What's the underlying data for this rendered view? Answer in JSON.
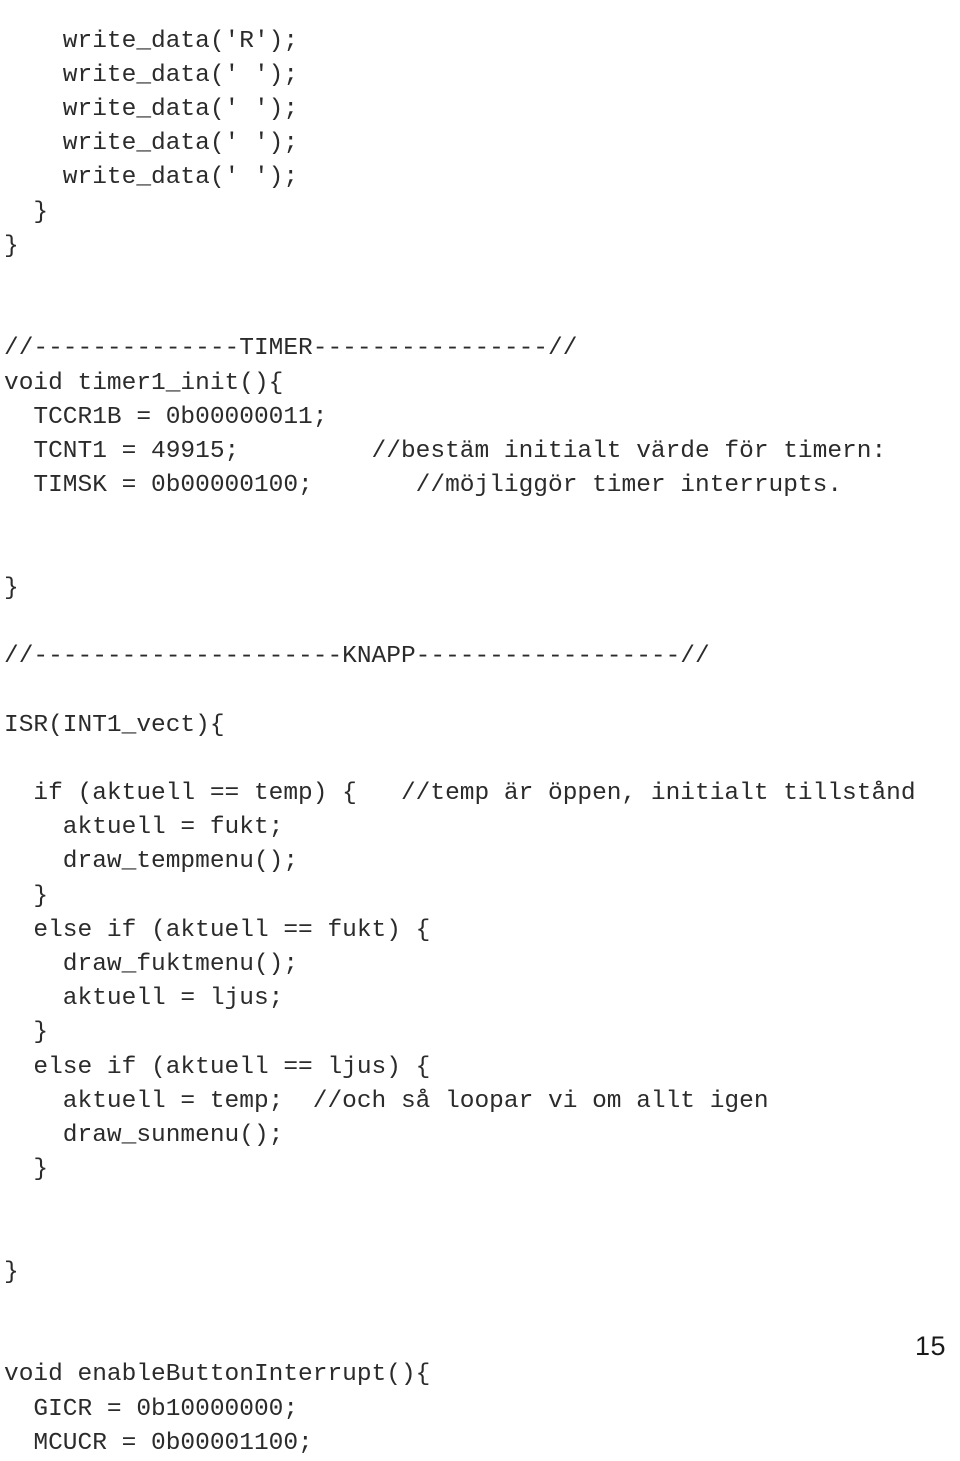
{
  "document": {
    "page_number": "15",
    "language": "C (AVR)",
    "code_lines": [
      "    write_data('R');",
      "    write_data(' ');",
      "    write_data(' ');",
      "    write_data(' ');",
      "    write_data(' ');",
      "  }",
      "}",
      "",
      "",
      "//--------------TIMER----------------//",
      "void timer1_init(){",
      "  TCCR1B = 0b00000011;",
      "  TCNT1 = 49915;         //bestäm initialt värde för timern:",
      "  TIMSK = 0b00000100;       //möjliggör timer interrupts.",
      "",
      "",
      "}",
      "",
      "//---------------------KNAPP------------------//",
      "",
      "ISR(INT1_vect){",
      "",
      "  if (aktuell == temp) {   //temp är öppen, initialt tillstånd",
      "    aktuell = fukt;",
      "    draw_tempmenu();",
      "  }",
      "  else if (aktuell == fukt) {",
      "    draw_fuktmenu();",
      "    aktuell = ljus;",
      "  }",
      "  else if (aktuell == ljus) {",
      "    aktuell = temp;  //och så loopar vi om allt igen",
      "    draw_sunmenu();",
      "  }",
      "",
      "",
      "}",
      "",
      "",
      "void enableButtonInterrupt(){",
      "  GICR = 0b10000000;",
      "  MCUCR = 0b00001100;"
    ]
  }
}
